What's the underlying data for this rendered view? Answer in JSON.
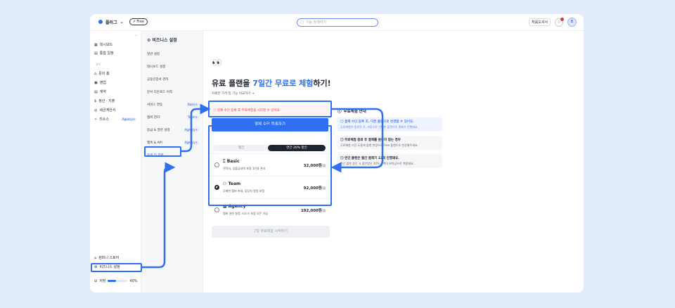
{
  "topbar": {
    "workspace": "플러그",
    "plan_badge": "⇗ Free",
    "search_placeholder": "기능 검색하기",
    "guide_button": "처음오셔서",
    "avatar_initial": "B"
  },
  "sidebar": {
    "items": [
      {
        "icon": "▦",
        "label": "대시보드"
      },
      {
        "icon": "▤",
        "label": "통합 일정"
      }
    ],
    "section": "관리",
    "group_items": [
      {
        "icon": "⌂",
        "label": "문의 홈"
      },
      {
        "icon": "▣",
        "label": "영업"
      },
      {
        "icon": "▤",
        "label": "계약"
      },
      {
        "icon": "$",
        "label": "정산 · 지출"
      },
      {
        "icon": "◎",
        "label": "세금계산서"
      },
      {
        "icon": "✧",
        "label": "리소스",
        "badge": "Agency+"
      }
    ],
    "bottom_items": [
      {
        "icon": "⌂",
        "label": "컴퍼니 스토어"
      },
      {
        "icon": "⚙",
        "label": "비즈니스 설정"
      }
    ],
    "usage_label": "저장",
    "usage_value": "40%",
    "usage_fraction": 0.4
  },
  "settings": {
    "title": "비즈니스 설정",
    "items": [
      {
        "label": "일반 설정"
      },
      {
        "label": "대시보드 설정"
      },
      {
        "label": "공동인증서 관리"
      },
      {
        "label": "문서 다운로드 이력"
      },
      {
        "label": "서비스 연동",
        "badge": "Basic+"
      },
      {
        "label": "멤버 관리",
        "badge": "Team+"
      },
      {
        "label": "등급 & 권한 설정",
        "badge": "Agency+"
      },
      {
        "label": "웹훅 & API",
        "badge": "Agency+"
      },
      {
        "label": "플랜 및 결제"
      }
    ]
  },
  "main": {
    "eyes": "👀",
    "title_pre": "유료 플랜을 ",
    "title_accent": "7일간 무료로 체험",
    "title_post": "하기!",
    "sub_link": "자세한 가격 및 기능 비교하기  →",
    "warning": "ⓘ 결제 수단 등록 후 무료체험을 시작할 수 있어요.",
    "pay_button": "결제 수단 등록하기",
    "billing_monthly": "월간",
    "billing_yearly": "연간 20% 할인",
    "plans": [
      {
        "name": "Basic",
        "icon": "⌶",
        "desc": "견적서, 입출금내역 포함 1인용 관리",
        "price": "32,000원",
        "unit": "/월",
        "selected": false
      },
      {
        "name": "Team",
        "icon": "⚇",
        "desc": "무제한 멤버 초대, 담당자 알림 포함",
        "price": "92,000원",
        "unit": "/월",
        "selected": true
      },
      {
        "name": "Agency",
        "icon": "▩",
        "desc": "멤버 권한 설정, 리소스 포함 모든 기능",
        "price": "192,000원",
        "unit": "/월",
        "selected": false
      }
    ],
    "start_button": "7일 무료체험 시작하기"
  },
  "info": {
    "title": "무료체험 안내",
    "cards": [
      {
        "title": "ⓘ 결제 수단 등록 후, 다른 플랜으로 변경할 수 있어요.",
        "desc": "무료체험이 종료된 후, 자동으로 선택한 플랜으로 결제가 진행돼요."
      },
      {
        "title": "ⓘ 무료체험 종료 후 결제를 원하지 않는 경우",
        "desc": "무료체험 기간 도중에 플랜 변경으로 Free 플랜으로 변경해주세요."
      },
      {
        "title": "ⓘ 연간 플랜은 월간 결제가 12회 진행돼요.",
        "desc": "연간 플랜 중단 시 할인받은 20% 금액이 위약금으로 책정돼요."
      }
    ]
  },
  "colors": {
    "accent": "#2f6ff2",
    "background": "#e3ecfb",
    "warning": "#e04040"
  }
}
